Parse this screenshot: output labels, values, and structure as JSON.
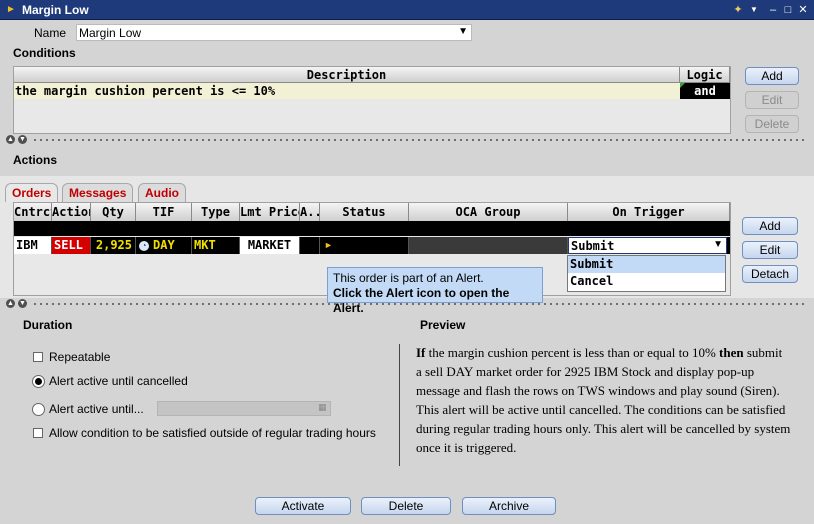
{
  "window": {
    "title": "Margin Low",
    "title_icon": "bell-icon",
    "controls": [
      "pin-icon",
      "menu-arrow-icon",
      "minimize-icon",
      "maximize-icon",
      "close-icon"
    ]
  },
  "name_field": {
    "label": "Name",
    "value": "Margin Low"
  },
  "conditions": {
    "heading": "Conditions",
    "columns": {
      "description": "Description",
      "logic": "Logic"
    },
    "rows": [
      {
        "description": "the margin cushion percent is <= 10%",
        "logic": "and"
      }
    ],
    "buttons": {
      "add": "Add",
      "edit": "Edit",
      "delete": "Delete"
    }
  },
  "actions": {
    "heading": "Actions",
    "tabs": [
      "Orders",
      "Messages",
      "Audio"
    ],
    "columns": [
      "Cntrct",
      "Action",
      "Qty",
      "TIF",
      "Type",
      "Lmt Price",
      "A...",
      "Status",
      "OCA Group",
      "On Trigger"
    ],
    "row": {
      "contract": "IBM",
      "action": "SELL",
      "qty": "2,925",
      "tif": "DAY",
      "type": "MKT",
      "lmt_price": "MARKET",
      "on_trigger": "Submit"
    },
    "trigger_options": [
      "Submit",
      "Cancel"
    ],
    "buttons": {
      "add": "Add",
      "edit": "Edit",
      "detach": "Detach"
    },
    "tooltip": {
      "line1": "This order is part of an Alert.",
      "line2": "Click the Alert icon to open the Alert."
    }
  },
  "duration": {
    "heading": "Duration",
    "repeatable": "Repeatable",
    "until_cancelled": "Alert active until cancelled",
    "until_date": "Alert active until...",
    "outside_hours": "Allow condition to be satisfied outside of regular trading hours"
  },
  "preview": {
    "heading": "Preview",
    "if_word": "If",
    "condition_text": " the margin cushion percent is less than or equal to 10% ",
    "then_word": "then",
    "body": " submit a sell DAY market order for 2925 IBM Stock and display pop-up message and flash the rows on TWS windows and play sound (Siren). This alert will be active until cancelled. The conditions can be satisfied during regular trading hours only. This alert will be cancelled by system once it is triggered."
  },
  "footer": {
    "activate": "Activate",
    "delete": "Delete",
    "archive": "Archive"
  },
  "colors": {
    "title_bar": "#1f3a7a",
    "sell_red": "#d40000",
    "qty_yellow": "#f0e000",
    "selected_highlight": "#c2daf5",
    "condition_row": "#f3f1d5"
  }
}
